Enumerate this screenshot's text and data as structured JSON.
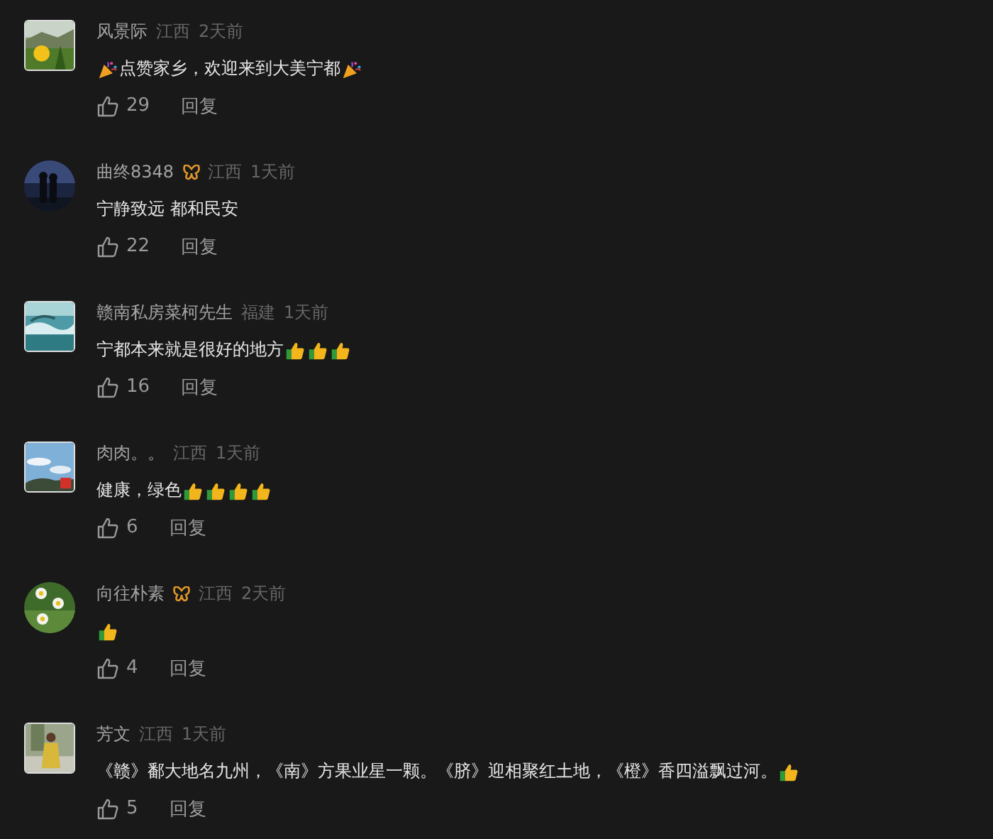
{
  "comments": [
    {
      "avatar": {
        "kind": "picture",
        "round": false
      },
      "name": "风景际",
      "badge": false,
      "region": "江西",
      "time": "2天前",
      "content": [
        {
          "kind": "party-popper"
        },
        {
          "kind": "text",
          "text": "点赞家乡，欢迎来到大美宁都"
        },
        {
          "kind": "party-popper"
        }
      ],
      "likes": "29",
      "reply": "回复"
    },
    {
      "avatar": {
        "kind": "picture",
        "round": true
      },
      "name": "曲终8348",
      "badge": true,
      "region": "江西",
      "time": "1天前",
      "content": [
        {
          "kind": "text",
          "text": "宁静致远 都和民安"
        }
      ],
      "likes": "22",
      "reply": "回复"
    },
    {
      "avatar": {
        "kind": "picture",
        "round": false
      },
      "name": "赣南私房菜柯先生",
      "badge": false,
      "region": "福建",
      "time": "1天前",
      "content": [
        {
          "kind": "text",
          "text": "宁都本来就是很好的地方"
        },
        {
          "kind": "thumbs-up"
        },
        {
          "kind": "thumbs-up"
        },
        {
          "kind": "thumbs-up"
        }
      ],
      "likes": "16",
      "reply": "回复"
    },
    {
      "avatar": {
        "kind": "picture",
        "round": false
      },
      "name": "肉肉。。",
      "badge": false,
      "region": "江西",
      "time": "1天前",
      "content": [
        {
          "kind": "text",
          "text": "健康，绿色"
        },
        {
          "kind": "thumbs-up"
        },
        {
          "kind": "thumbs-up"
        },
        {
          "kind": "thumbs-up"
        },
        {
          "kind": "thumbs-up"
        }
      ],
      "likes": "6",
      "reply": "回复"
    },
    {
      "avatar": {
        "kind": "picture",
        "round": true
      },
      "name": "向往朴素",
      "badge": true,
      "region": "江西",
      "time": "2天前",
      "content": [
        {
          "kind": "thumbs-up"
        }
      ],
      "likes": "4",
      "reply": "回复"
    },
    {
      "avatar": {
        "kind": "picture",
        "round": false
      },
      "name": "芳文",
      "badge": false,
      "region": "江西",
      "time": "1天前",
      "content": [
        {
          "kind": "text",
          "text": "《赣》鄱大地名九州，《南》方果业星一颗。《脐》迎相聚红土地，《橙》香四溢飘过河。"
        },
        {
          "kind": "thumbs-up"
        }
      ],
      "likes": "5",
      "reply": "回复"
    }
  ]
}
